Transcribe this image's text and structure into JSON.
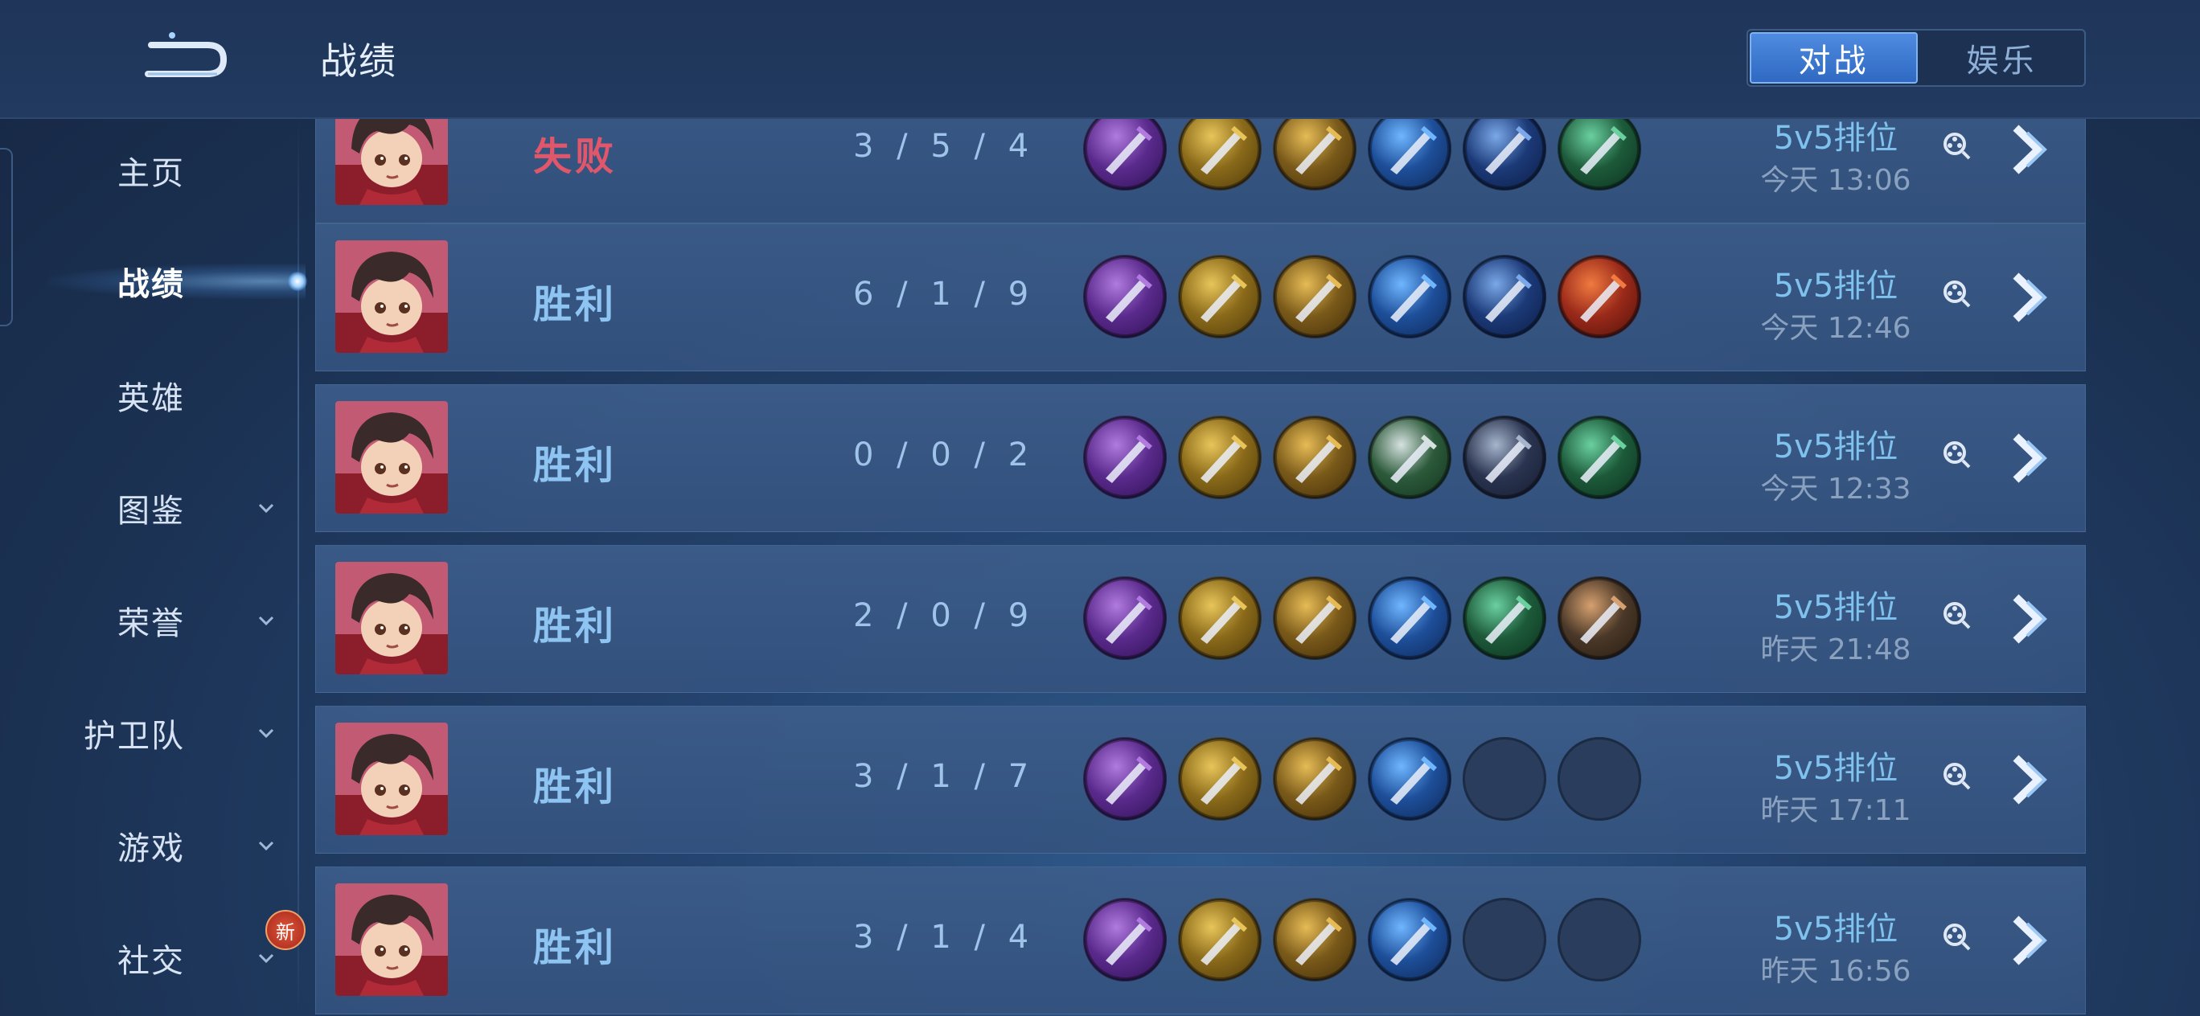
{
  "header": {
    "title": "战绩"
  },
  "tabs": [
    {
      "label": "对战",
      "active": true
    },
    {
      "label": "娱乐",
      "active": false
    }
  ],
  "sidebar": {
    "items": [
      {
        "label": "主页",
        "chevron": false
      },
      {
        "label": "战绩",
        "chevron": false,
        "active": true
      },
      {
        "label": "英雄",
        "chevron": false
      },
      {
        "label": "图鉴",
        "chevron": true
      },
      {
        "label": "荣誉",
        "chevron": true
      },
      {
        "label": "护卫队",
        "chevron": true
      },
      {
        "label": "游戏",
        "chevron": true
      },
      {
        "label": "社交",
        "chevron": true
      }
    ],
    "new_badge": "新"
  },
  "matches": [
    {
      "result": "失败",
      "outcome": "loss",
      "kda": "3 / 5 / 4",
      "mode": "5v5排位",
      "time": "今天 13:06",
      "items": [
        "purple-axe",
        "gold-boots",
        "gold-blade",
        "blue-sword",
        "blue-bow",
        "green-dagger"
      ]
    },
    {
      "result": "胜利",
      "outcome": "win",
      "kda": "6 / 1 / 9",
      "mode": "5v5排位",
      "time": "今天 12:46",
      "items": [
        "purple-axe",
        "gold-boots",
        "gold-blade",
        "blue-sword",
        "blue-bow",
        "red-spear"
      ]
    },
    {
      "result": "胜利",
      "outcome": "win",
      "kda": "0 / 0 / 2",
      "mode": "5v5排位",
      "time": "今天 12:33",
      "items": [
        "purple-axe",
        "gold-boots",
        "gold-blade",
        "green-armor",
        "dark-staff",
        "green-dagger"
      ]
    },
    {
      "result": "胜利",
      "outcome": "win",
      "kda": "2 / 0 / 9",
      "mode": "5v5排位",
      "time": "昨天 21:48",
      "items": [
        "purple-axe",
        "gold-boots",
        "gold-blade",
        "blue-sword",
        "green-dagger",
        "bronze-gauntlet"
      ]
    },
    {
      "result": "胜利",
      "outcome": "win",
      "kda": "3 / 1 / 7",
      "mode": "5v5排位",
      "time": "昨天 17:11",
      "items": [
        "purple-axe",
        "gold-boots",
        "gold-blade",
        "blue-sword",
        "empty",
        "empty"
      ]
    },
    {
      "result": "胜利",
      "outcome": "win",
      "kda": "3 / 1 / 4",
      "mode": "5v5排位",
      "time": "昨天 16:56",
      "items": [
        "purple-axe",
        "gold-boots",
        "gold-blade",
        "blue-sword",
        "empty",
        "empty"
      ]
    }
  ],
  "colors": {
    "win": "#8ec4f2",
    "loss": "#e0566a",
    "accent": "#2f69c2"
  }
}
